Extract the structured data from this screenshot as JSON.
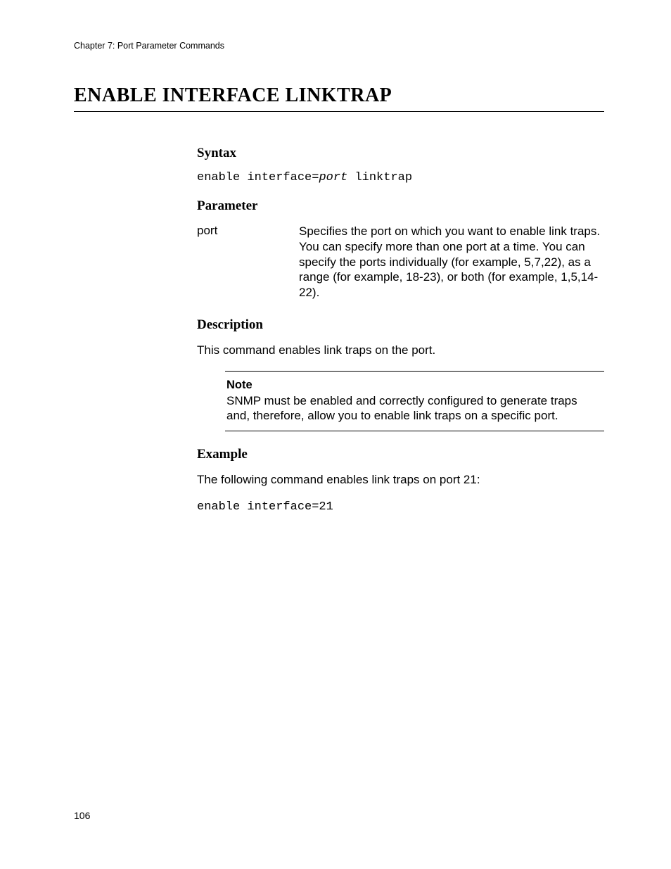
{
  "header": {
    "running": "Chapter 7: Port Parameter Commands"
  },
  "title": "ENABLE INTERFACE LINKTRAP",
  "sections": {
    "syntax": {
      "heading": "Syntax",
      "cmd_prefix": "enable interface=",
      "cmd_arg": "port",
      "cmd_suffix": " linktrap"
    },
    "parameter": {
      "heading": "Parameter",
      "name": "port",
      "description": "Specifies the port on which you want to enable link traps. You can specify more than one port at a time. You can specify the ports individually (for example, 5,7,22), as a range (for example, 18-23), or both (for example, 1,5,14-22)."
    },
    "description": {
      "heading": "Description",
      "text": "This command enables link traps on the port.",
      "note_label": "Note",
      "note_text": "SNMP must be enabled and correctly configured to generate traps and, therefore, allow you to enable link traps on a specific port."
    },
    "example": {
      "heading": "Example",
      "intro": "The following command enables link traps on port 21:",
      "code": "enable interface=21"
    }
  },
  "page_number": "106"
}
